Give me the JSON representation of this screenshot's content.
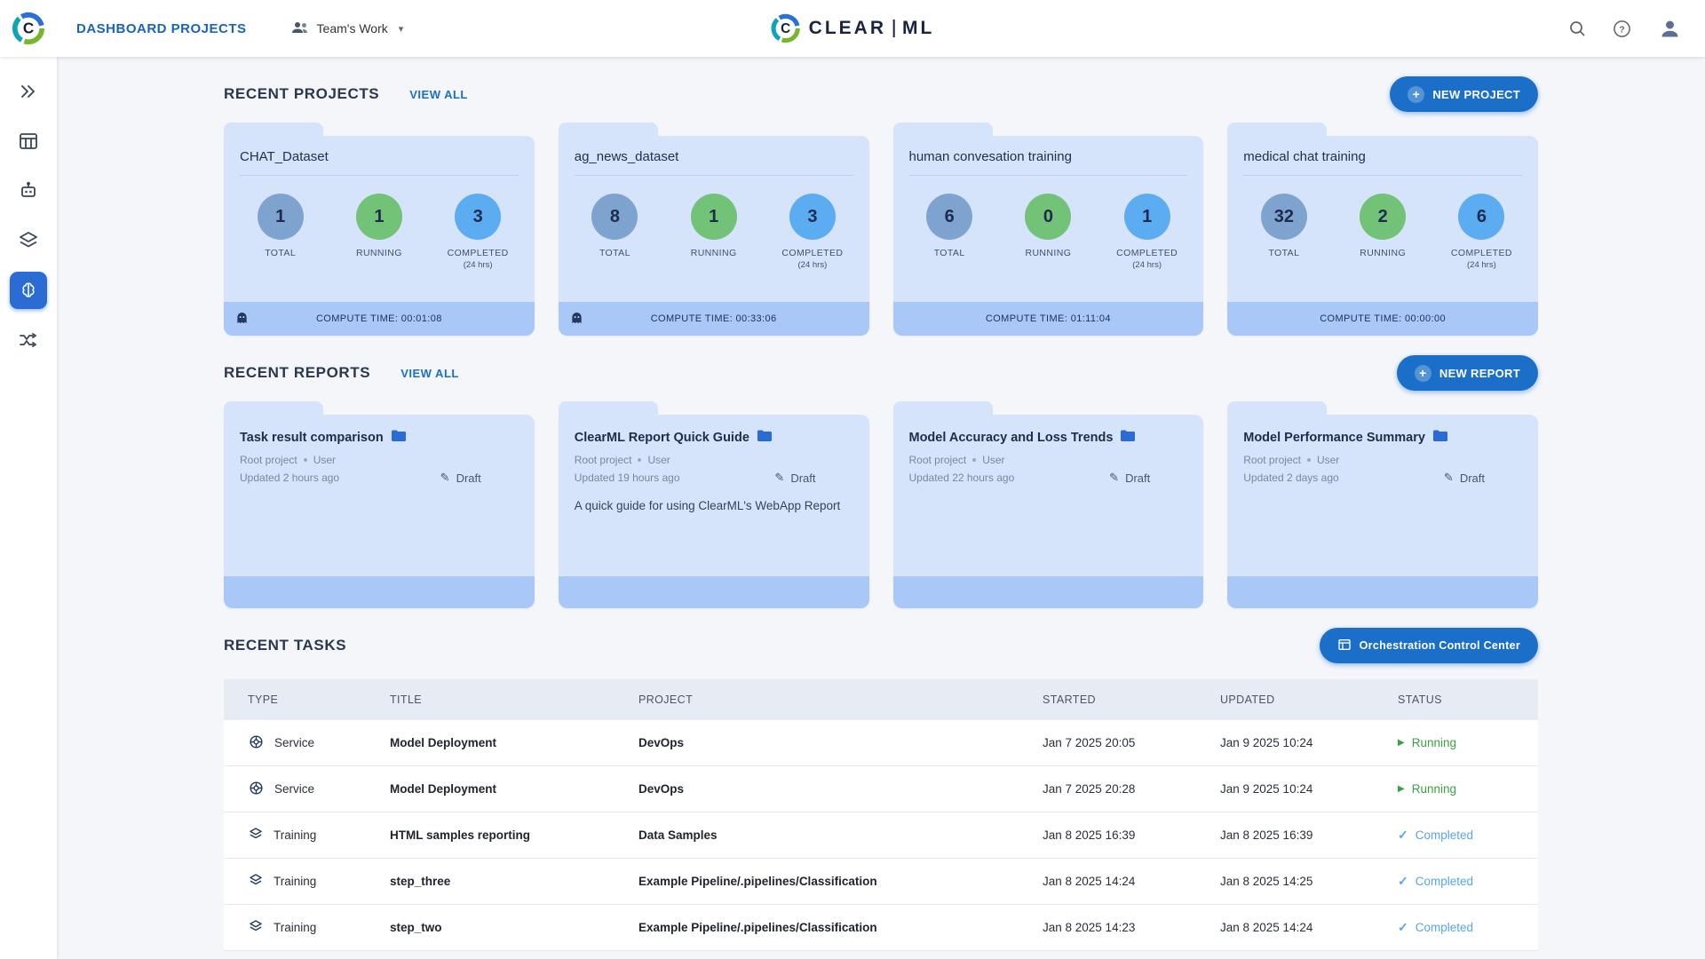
{
  "topbar": {
    "title": "DASHBOARD PROJECTS",
    "workspace": "Team's Work",
    "logo_clear": "CLEAR",
    "logo_ml": "ML"
  },
  "icons": {
    "caret_down": "▾",
    "plus": "+",
    "draft": "✎",
    "running": "▶",
    "completed": "✓"
  },
  "colors": {
    "accent_blue": "#1b6fc9",
    "card_blue": "#d6e4fb",
    "strip_blue": "#a9c8f7",
    "running_green": "#3aa044",
    "completed_blue": "#57a6e6"
  },
  "projects_section": {
    "heading": "RECENT PROJECTS",
    "view_all": "VIEW ALL",
    "new_button": "NEW PROJECT",
    "stat_labels": {
      "total": "TOTAL",
      "running": "RUNNING",
      "completed": "COMPLETED",
      "completed_sub": "(24 hrs)"
    },
    "cards": [
      {
        "title": "CHAT_Dataset",
        "total": "1",
        "running": "1",
        "completed": "3",
        "compute": "COMPUTE TIME: 00:01:08"
      },
      {
        "title": "ag_news_dataset",
        "total": "8",
        "running": "1",
        "completed": "3",
        "compute": "COMPUTE TIME: 00:33:06"
      },
      {
        "title": "human convesation training",
        "total": "6",
        "running": "0",
        "completed": "1",
        "compute": "COMPUTE TIME: 01:11:04"
      },
      {
        "title": "medical chat training",
        "total": "32",
        "running": "2",
        "completed": "6",
        "compute": "COMPUTE TIME: 00:00:00"
      }
    ]
  },
  "reports_section": {
    "heading": "RECENT REPORTS",
    "view_all": "VIEW ALL",
    "new_button": "NEW REPORT",
    "cards": [
      {
        "title": "Task result comparison",
        "project": "Root project",
        "author": "User",
        "updated": "Updated 2 hours ago",
        "status": "Draft",
        "description": ""
      },
      {
        "title": "ClearML Report Quick Guide",
        "project": "Root project",
        "author": "User",
        "updated": "Updated 19 hours ago",
        "status": "Draft",
        "description": "A quick guide for using ClearML's WebApp Report"
      },
      {
        "title": "Model Accuracy and Loss Trends",
        "project": "Root project",
        "author": "User",
        "updated": "Updated 22 hours ago",
        "status": "Draft",
        "description": ""
      },
      {
        "title": "Model Performance Summary",
        "project": "Root project",
        "author": "User",
        "updated": "Updated 2 days ago",
        "status": "Draft",
        "description": ""
      }
    ]
  },
  "tasks_section": {
    "heading": "RECENT TASKS",
    "orchestration_button": "Orchestration Control Center",
    "columns": [
      "TYPE",
      "TITLE",
      "PROJECT",
      "STARTED",
      "UPDATED",
      "STATUS"
    ],
    "rows": [
      {
        "type": "Service",
        "title": "Model Deployment",
        "project": "DevOps",
        "started": "Jan 7 2025 20:05",
        "updated": "Jan 9 2025 10:24",
        "status": "Running"
      },
      {
        "type": "Service",
        "title": "Model Deployment",
        "project": "DevOps",
        "started": "Jan 7 2025 20:28",
        "updated": "Jan 9 2025 10:24",
        "status": "Running"
      },
      {
        "type": "Training",
        "title": "HTML samples reporting",
        "project": "Data Samples",
        "started": "Jan 8 2025 16:39",
        "updated": "Jan 8 2025 16:39",
        "status": "Completed"
      },
      {
        "type": "Training",
        "title": "step_three",
        "project": "Example Pipeline/.pipelines/Classification",
        "started": "Jan 8 2025 14:24",
        "updated": "Jan 8 2025 14:25",
        "status": "Completed"
      },
      {
        "type": "Training",
        "title": "step_two",
        "project": "Example Pipeline/.pipelines/Classification",
        "started": "Jan 8 2025 14:23",
        "updated": "Jan 8 2025 14:24",
        "status": "Completed"
      }
    ]
  }
}
